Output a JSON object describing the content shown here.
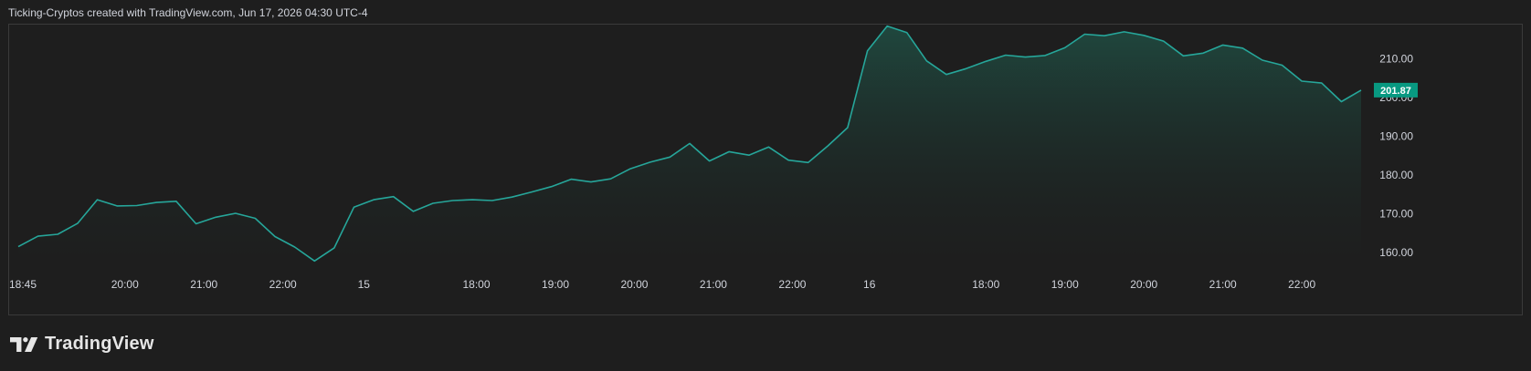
{
  "header": {
    "text": "Ticking-Cryptos created with TradingView.com, Jun 17, 2026 04:30 UTC-4"
  },
  "brand": {
    "name": "TradingView"
  },
  "colors": {
    "line": "#26a69a",
    "area_top": "#1f4a40",
    "background": "#1e1e1e",
    "badge": "#089981"
  },
  "chart_data": {
    "type": "area",
    "ylim": [
      156,
      219
    ],
    "yticks": [
      160,
      170,
      180,
      190,
      200,
      210
    ],
    "ytick_labels": [
      "160.00",
      "170.00",
      "180.00",
      "190.00",
      "200.00",
      "210.00"
    ],
    "x_range": [
      0,
      68
    ],
    "xticks": [
      {
        "x": 0,
        "label": "18:45"
      },
      {
        "x": 5.4,
        "label": "20:00"
      },
      {
        "x": 9.4,
        "label": "21:00"
      },
      {
        "x": 13.4,
        "label": "22:00"
      },
      {
        "x": 17.5,
        "label": "15"
      },
      {
        "x": 23.2,
        "label": "18:00"
      },
      {
        "x": 27.2,
        "label": "19:00"
      },
      {
        "x": 31.2,
        "label": "20:00"
      },
      {
        "x": 35.2,
        "label": "21:00"
      },
      {
        "x": 39.2,
        "label": "22:00"
      },
      {
        "x": 43.1,
        "label": "16"
      },
      {
        "x": 49.0,
        "label": "18:00"
      },
      {
        "x": 53.0,
        "label": "19:00"
      },
      {
        "x": 57.0,
        "label": "20:00"
      },
      {
        "x": 61.0,
        "label": "21:00"
      },
      {
        "x": 65.0,
        "label": "22:00"
      }
    ],
    "values": [
      161.5,
      164.2,
      164.7,
      167.5,
      173.6,
      172.0,
      172.1,
      172.9,
      173.2,
      167.4,
      169.1,
      170.1,
      168.8,
      164.1,
      161.4,
      157.8,
      161.2,
      171.7,
      173.6,
      174.4,
      170.6,
      172.7,
      173.4,
      173.6,
      173.4,
      174.3,
      175.6,
      177.0,
      178.9,
      178.2,
      179.0,
      181.6,
      183.3,
      184.6,
      188.1,
      183.6,
      186.0,
      185.1,
      187.2,
      183.8,
      183.2,
      187.5,
      192.2,
      212.0,
      218.4,
      216.7,
      209.4,
      205.9,
      207.4,
      209.3,
      210.9,
      210.4,
      210.8,
      212.8,
      216.3,
      215.9,
      216.9,
      216.0,
      214.5,
      210.7,
      211.4,
      213.5,
      212.7,
      209.6,
      208.3,
      204.2,
      203.7,
      198.9,
      201.87
    ],
    "last_value_label": "201.87"
  }
}
